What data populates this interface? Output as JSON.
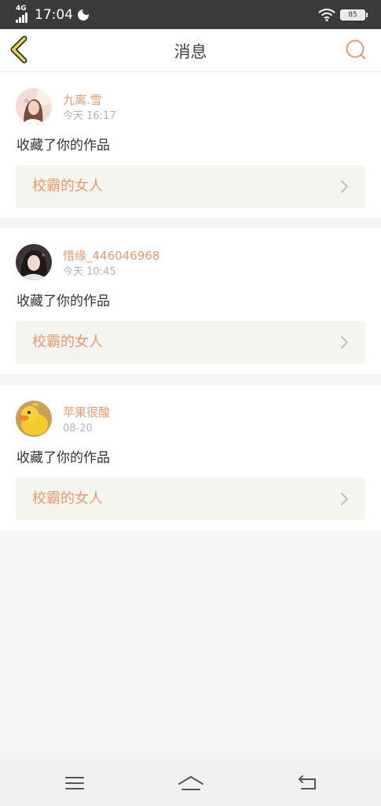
{
  "status_bar": {
    "network": "4G",
    "time": "17:04",
    "battery": "85"
  },
  "header": {
    "title": "消息",
    "back_icon": "chevron-left-icon",
    "search_icon": "search-icon"
  },
  "colors": {
    "accent": "#e79a6f",
    "back_icon": "#e5d24d",
    "link_bg": "#f5f5ef",
    "page_bg": "#f7f6f6"
  },
  "messages": [
    {
      "user": "九离.雪",
      "time": "今天 16:17",
      "action": "收藏了你的作品",
      "work": "校霸的女人"
    },
    {
      "user": "惜缘_446046968",
      "time": "今天 10:45",
      "action": "收藏了你的作品",
      "work": "校霸的女人"
    },
    {
      "user": "苹果很酸",
      "time": "08-20",
      "action": "收藏了你的作品",
      "work": "校霸的女人"
    }
  ],
  "nav": {
    "icons": [
      "menu-icon",
      "home-icon",
      "back-icon"
    ]
  }
}
